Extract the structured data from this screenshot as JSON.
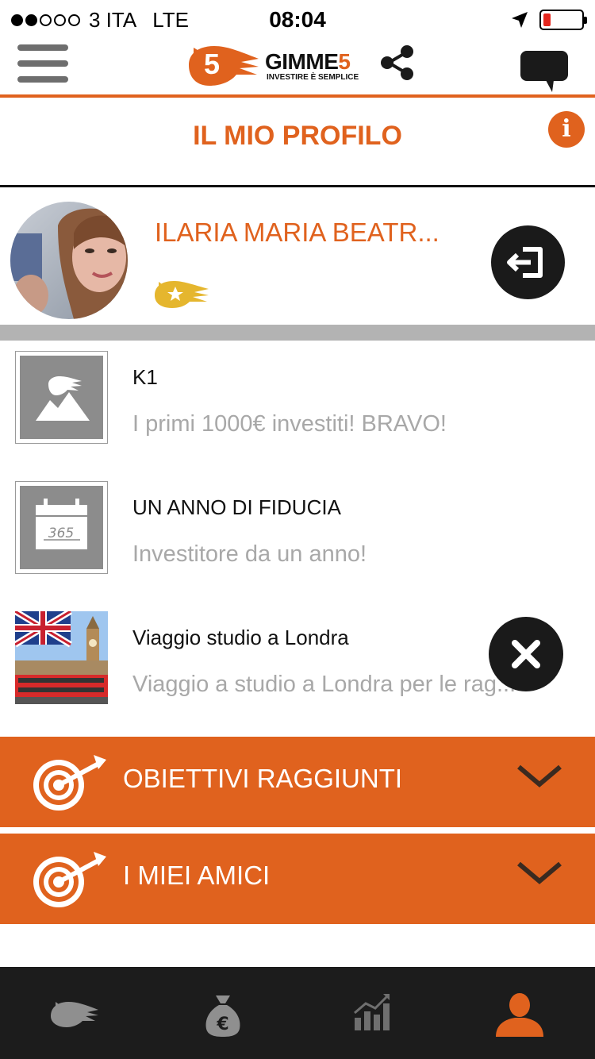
{
  "status_bar": {
    "carrier": "3 ITA",
    "network": "LTE",
    "time": "08:04",
    "signal_bars_filled": 2,
    "signal_bars_total": 5,
    "battery_level": "low"
  },
  "header": {
    "logo": {
      "digit": "5",
      "brand_main": "GIMME",
      "brand_suffix": "5",
      "tagline": "INVESTIRE È SEMPLICE"
    },
    "menu_icon": "hamburger-icon",
    "share_icon": "share-icon",
    "chat_icon": "chat-bubble-icon"
  },
  "page": {
    "title": "IL MIO PROFILO",
    "info_icon": "i"
  },
  "profile": {
    "name": "ILARIA MARIA BEATR...",
    "badge_icon": "star-bird-badge-icon",
    "logout_icon": "logout-icon"
  },
  "goals": [
    {
      "name": "K1",
      "description": "I primi 1000€ investiti! BRAVO!",
      "icon": "mountain-bird-icon"
    },
    {
      "name": "UN ANNO DI FIDUCIA",
      "description": "Investitore da un anno!",
      "icon": "calendar-icon",
      "calendar_number": "365"
    },
    {
      "name": "Viaggio studio a Londra",
      "description": "Viaggio a studio a Londra per le rag...",
      "icon": "london-photo"
    }
  ],
  "sections": [
    {
      "label": "OBIETTIVI RAGGIUNTI",
      "icon": "target-icon"
    },
    {
      "label": "I MIEI AMICI",
      "icon": "target-icon"
    }
  ],
  "tabbar": [
    {
      "icon": "bird-icon",
      "active": false
    },
    {
      "icon": "money-bag-icon",
      "symbol": "€",
      "active": false
    },
    {
      "icon": "chart-icon",
      "active": false
    },
    {
      "icon": "profile-icon",
      "active": true
    }
  ],
  "colors": {
    "accent": "#e0621e",
    "dark": "#1a1a1a",
    "gray_text": "#a8a8a8",
    "divider_gray": "#b3b3b3"
  }
}
